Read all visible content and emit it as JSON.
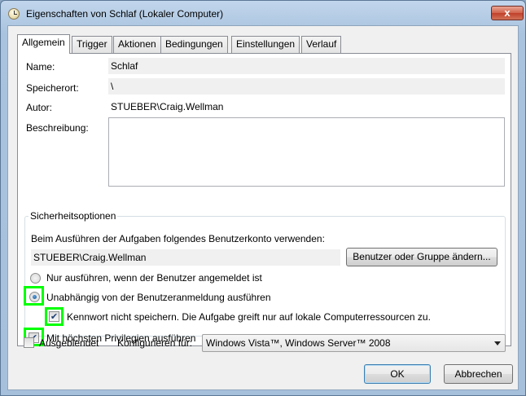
{
  "window": {
    "title": "Eigenschaften von Schlaf (Lokaler Computer)",
    "close_glyph": "x"
  },
  "tabs": [
    {
      "label": "Allgemein",
      "active": true
    },
    {
      "label": "Trigger"
    },
    {
      "label": "Aktionen"
    },
    {
      "label": "Bedingungen"
    },
    {
      "label": "Einstellungen"
    },
    {
      "label": "Verlauf"
    }
  ],
  "general": {
    "name_label": "Name:",
    "name_value": "Schlaf",
    "location_label": "Speicherort:",
    "location_value": "\\",
    "author_label": "Autor:",
    "author_value": "STUEBER\\Craig.Wellman",
    "description_label": "Beschreibung:",
    "description_value": ""
  },
  "security": {
    "legend": "Sicherheitsoptionen",
    "account_prompt": "Beim Ausführen der Aufgaben folgendes Benutzerkonto verwenden:",
    "account_value": "STUEBER\\Craig.Wellman",
    "change_button": "Benutzer oder Gruppe ändern...",
    "radio_logged_on": {
      "label": "Nur ausführen, wenn der Benutzer angemeldet ist",
      "selected": false
    },
    "radio_independent": {
      "label": "Unabhängig von der Benutzeranmeldung ausführen",
      "selected": true
    },
    "check_no_password": {
      "label": "Kennwort nicht speichern. Die Aufgabe greift nur auf lokale Computerressourcen zu.",
      "checked": true
    },
    "check_highest": {
      "label": "Mit höchsten Privilegien ausführen",
      "checked": true
    },
    "highlight_color": "#00ff00"
  },
  "footer": {
    "hidden_label": "Ausgeblendet",
    "hidden_checked": false,
    "configure_label": "Konfigurieren für:",
    "configure_value": "Windows Vista™, Windows Server™ 2008",
    "ok_button": "OK",
    "cancel_button": "Abbrechen"
  }
}
